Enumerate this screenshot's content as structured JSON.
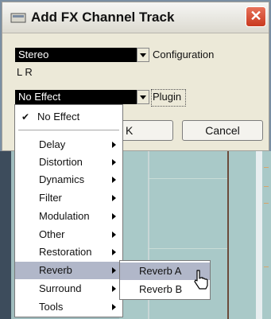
{
  "dialog": {
    "title": "Add FX Channel Track",
    "close_label": "✕",
    "configuration": {
      "value": "Stereo",
      "label": "Configuration"
    },
    "channels_label": "L R",
    "plugin": {
      "value": "No Effect",
      "label": "Plugin"
    },
    "ok_label": "OK",
    "ok_visible": "K",
    "cancel_label": "Cancel"
  },
  "menu": {
    "checked_item": "No Effect",
    "items": [
      {
        "label": "Delay",
        "has_submenu": true
      },
      {
        "label": "Distortion",
        "has_submenu": true
      },
      {
        "label": "Dynamics",
        "has_submenu": true
      },
      {
        "label": "Filter",
        "has_submenu": true
      },
      {
        "label": "Modulation",
        "has_submenu": true
      },
      {
        "label": "Other",
        "has_submenu": true
      },
      {
        "label": "Restoration",
        "has_submenu": true
      },
      {
        "label": "Reverb",
        "has_submenu": true,
        "highlighted": true
      },
      {
        "label": "Surround",
        "has_submenu": true
      },
      {
        "label": "Tools",
        "has_submenu": true
      }
    ]
  },
  "submenu": {
    "items": [
      {
        "label": "Reverb A",
        "highlighted": true
      },
      {
        "label": "Reverb B"
      }
    ]
  },
  "colors": {
    "highlight": "#b1b7c9",
    "close": "#c9391f"
  }
}
